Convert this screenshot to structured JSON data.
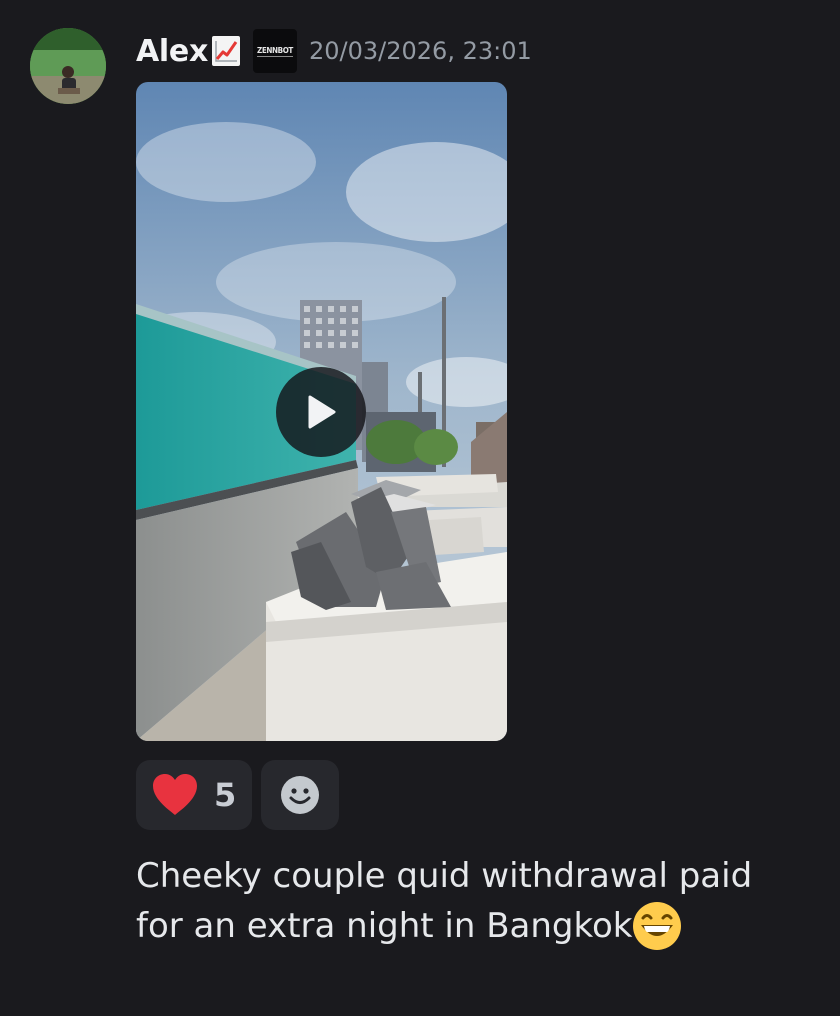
{
  "message": {
    "author": "Alex",
    "author_emoji": "chart-increasing-emoji",
    "server_tag": "ZENNBOT",
    "timestamp": "20/03/2026, 23:01",
    "attachment": {
      "type": "video",
      "description_icon": "play-icon"
    },
    "reactions": [
      {
        "emoji": "heart-icon",
        "count": "5",
        "color": "#e8333f"
      },
      {
        "emoji": "add-reaction-icon"
      }
    ],
    "text": "Cheeky couple quid withdrawal paid for an extra night in Bangkok",
    "trailing_emoji": "grinning-face-emoji"
  },
  "colors": {
    "background": "#1a1a1e",
    "username": "#f2f3f5",
    "timestamp": "#949ba4",
    "reaction_bg": "#27282d"
  }
}
